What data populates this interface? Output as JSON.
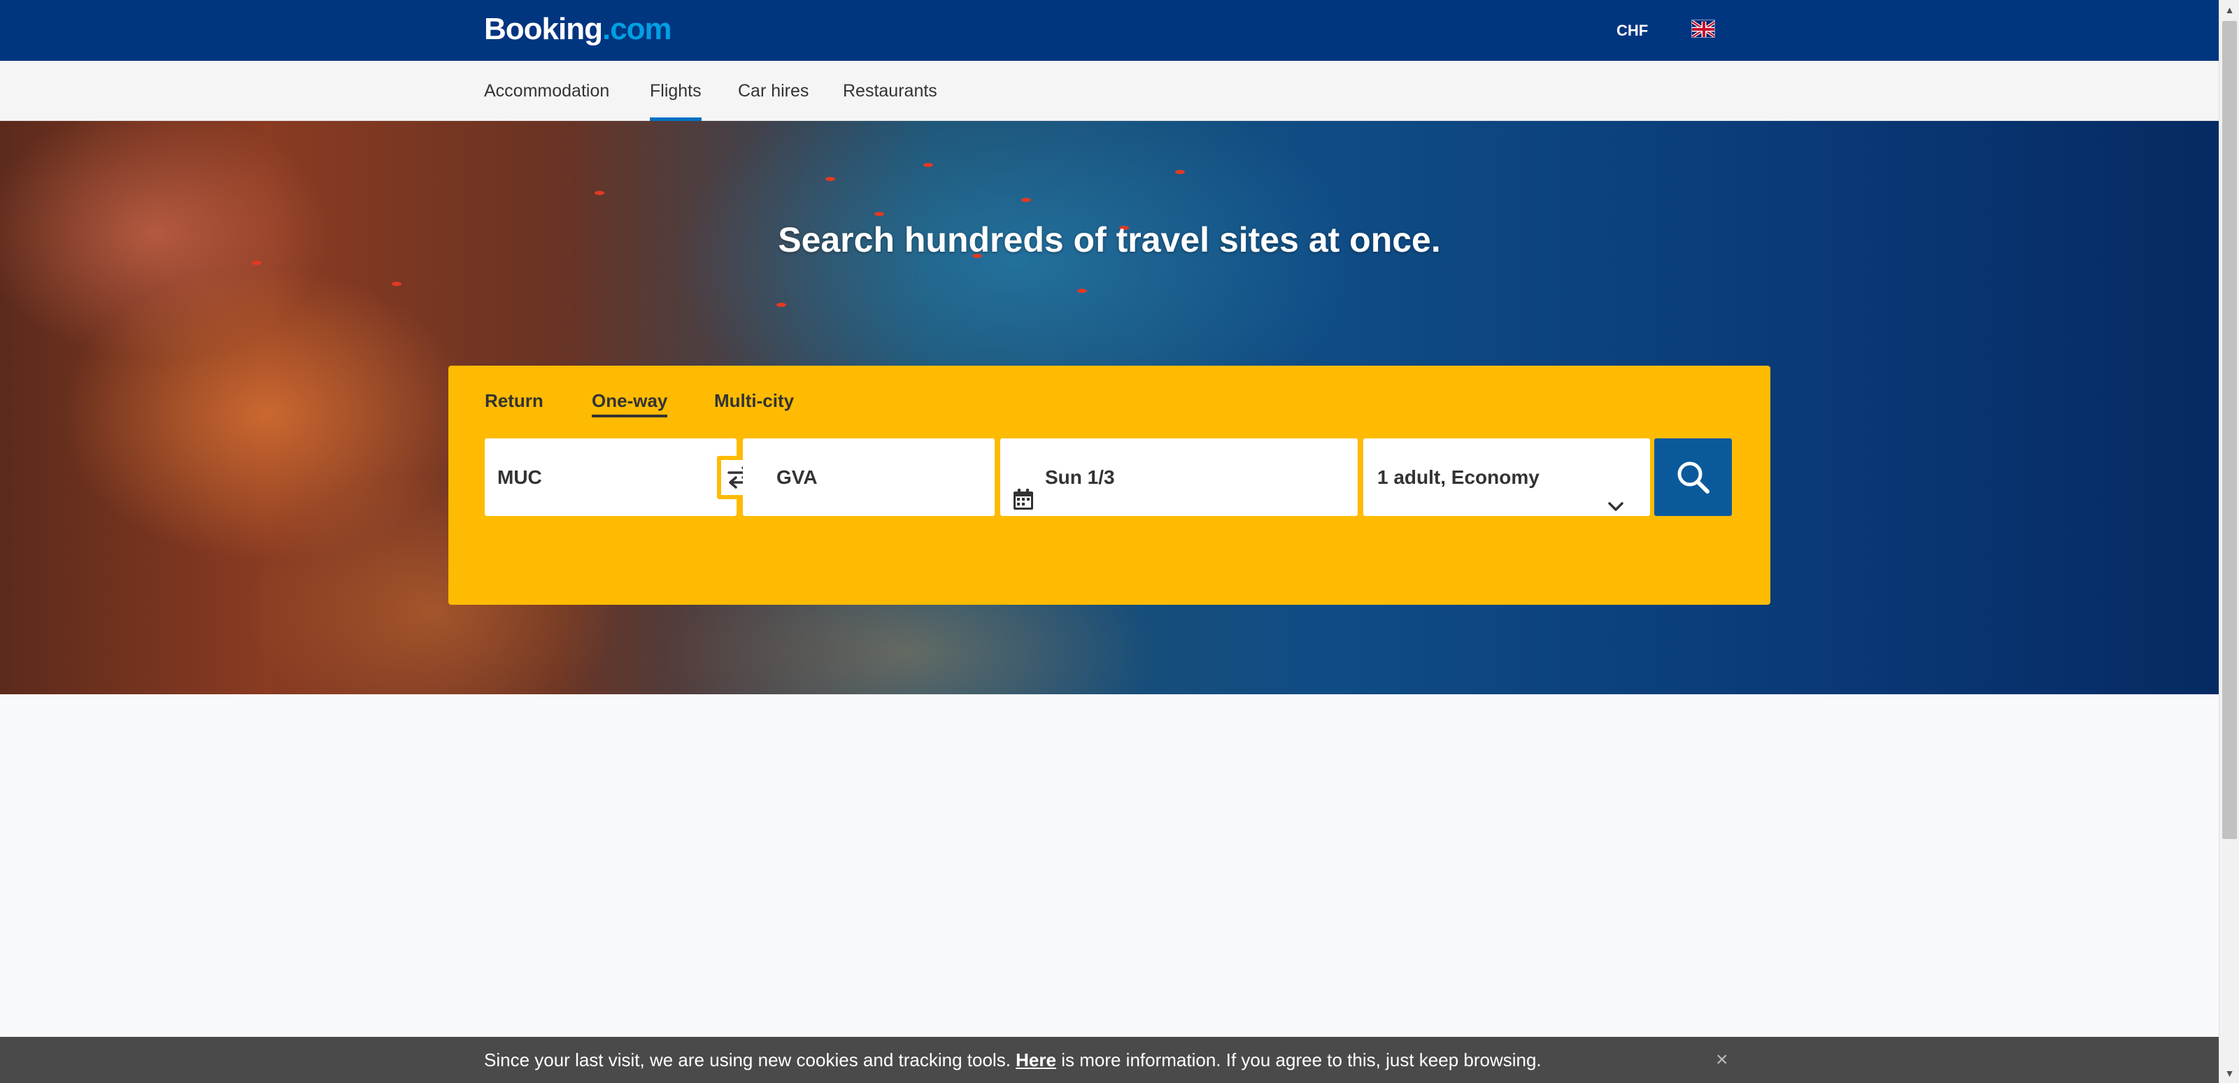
{
  "header": {
    "logo_main": "Booking",
    "logo_dot": ".com",
    "currency": "CHF",
    "flag_icon": "uk-flag-icon"
  },
  "nav": {
    "items": [
      {
        "label": "Accommodation"
      },
      {
        "label": "Flights",
        "active": true
      },
      {
        "label": "Car hires"
      },
      {
        "label": "Restaurants"
      }
    ]
  },
  "hero": {
    "title": "Search hundreds of travel sites at once."
  },
  "search": {
    "trip_types": [
      {
        "label": "Return"
      },
      {
        "label": "One-way",
        "active": true
      },
      {
        "label": "Multi-city"
      }
    ],
    "origin": "MUC",
    "destination": "GVA",
    "date": "Sun 1/3",
    "travellers": "1 adult, Economy",
    "swap_icon": "swap-arrows-icon",
    "calendar_icon": "calendar-icon",
    "chevron_icon": "chevron-down-icon",
    "search_icon": "search-icon"
  },
  "cookie": {
    "text_before": "Since your last visit, we are using new cookies and tracking tools.",
    "link": "Here",
    "text_after": "is more information. If you agree to this, just keep browsing.",
    "close": "×"
  },
  "colors": {
    "header_bg": "#003580",
    "panel_bg": "#febb02",
    "search_button": "#0a5a9b",
    "accent": "#0071c2",
    "cookie_bg": "#4a4a4a"
  }
}
